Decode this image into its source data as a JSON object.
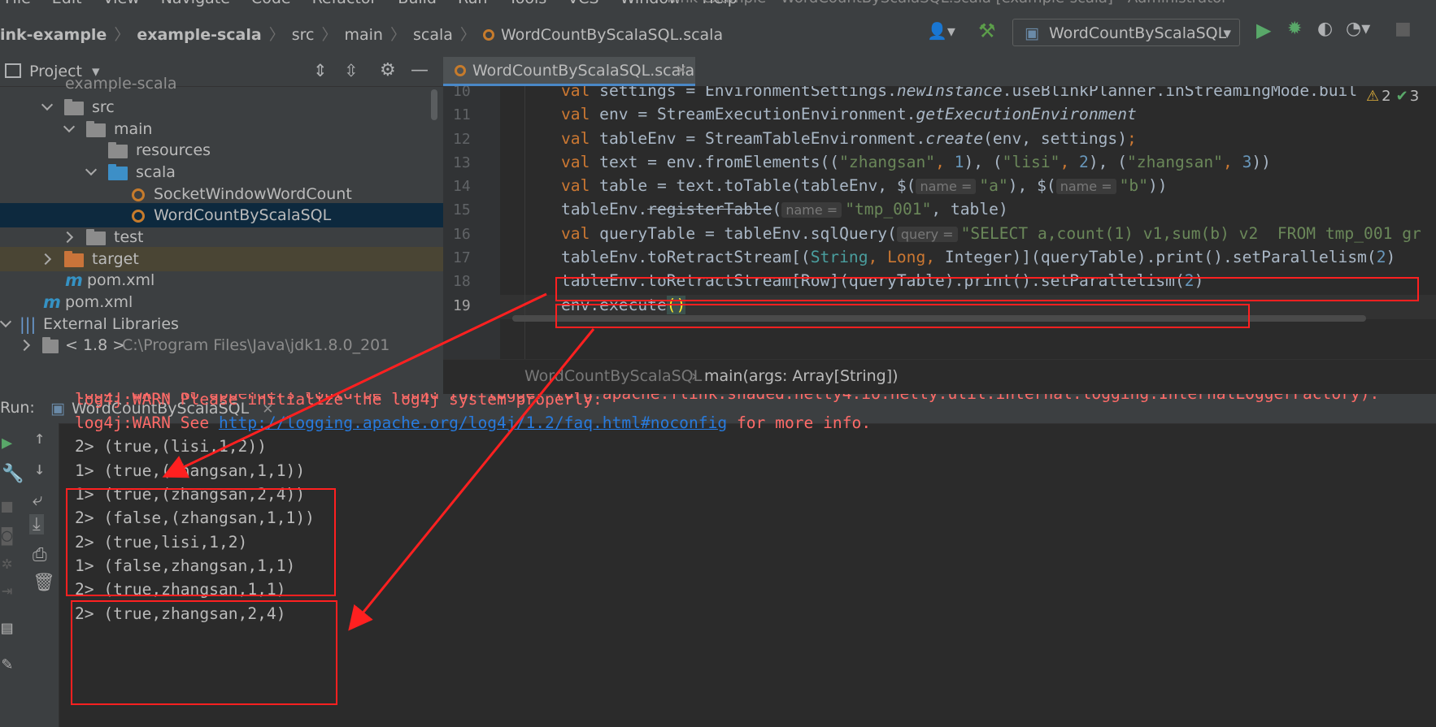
{
  "menubar": {
    "items": [
      "File",
      "Edit",
      "View",
      "Navigate",
      "Code",
      "Refactor",
      "Build",
      "Run",
      "Tools",
      "VCS",
      "Window",
      "Help"
    ],
    "window_title": "flink-example - WordCountByScalaSQL.scala [example-scala] - Administrator"
  },
  "breadcrumb": {
    "items": [
      "ink-example",
      "example-scala",
      "src",
      "main",
      "scala",
      "WordCountByScalaSQL.scala"
    ]
  },
  "toolbar": {
    "run_config": "WordCountByScalaSQL"
  },
  "project": {
    "title": "Project",
    "tree": [
      {
        "label": "example-scala",
        "kind": "module",
        "depth": 1
      },
      {
        "label": "src",
        "kind": "folder",
        "depth": 2,
        "expanded": true
      },
      {
        "label": "main",
        "kind": "folder",
        "depth": 3,
        "expanded": true
      },
      {
        "label": "resources",
        "kind": "resources-folder",
        "depth": 4
      },
      {
        "label": "scala",
        "kind": "source-folder",
        "depth": 4,
        "expanded": true
      },
      {
        "label": "SocketWindowWordCount",
        "kind": "scala-object",
        "depth": 5
      },
      {
        "label": "WordCountByScalaSQL",
        "kind": "scala-object",
        "depth": 5,
        "selected": true
      },
      {
        "label": "test",
        "kind": "folder",
        "depth": 3,
        "expanded": false
      },
      {
        "label": "target",
        "kind": "excluded-folder",
        "depth": 2,
        "expanded": false
      },
      {
        "label": "pom.xml",
        "kind": "maven",
        "depth": 2
      },
      {
        "label": "pom.xml",
        "kind": "maven",
        "depth": 1
      },
      {
        "label": "External Libraries",
        "kind": "libraries",
        "depth": 0,
        "expanded": true
      },
      {
        "label": "< 1.8 >",
        "kind": "jdk",
        "depth": 1,
        "detail": "C:\\Program Files\\Java\\jdk1.8.0_201"
      }
    ]
  },
  "editor": {
    "tab_label": "WordCountByScalaSQL.scala",
    "line_numbers": [
      "10",
      "11",
      "12",
      "13",
      "14",
      "15",
      "16",
      "17",
      "18",
      "19"
    ],
    "warnings": "2",
    "checks": "3",
    "breadcrumb_object": "WordCountByScalaSQL",
    "breadcrumb_method": "main(args: Array[String])",
    "hint_name": "name =",
    "hint_query": "query =",
    "code": {
      "l10_a": "val",
      "l10_b": " settings = EnvironmentSettings.",
      "l10_c": "newInstance",
      "l10_d": ".useBlinkPlanner.inStreamingMode.buil",
      "l11_a": "val",
      "l11_b": " env = StreamExecutionEnvironment.",
      "l11_c": "getExecutionEnvironment",
      "l12_a": "val",
      "l12_b": " tableEnv = StreamTableEnvironment.",
      "l12_c": "create",
      "l12_d": "(env, settings)",
      "l12_e": ";",
      "l13_a": "val",
      "l13_b": " text = env.fromElements((",
      "l13_c": "\"zhangsan\"",
      "l13_d": ", ",
      "l13_e": "1",
      "l13_f": "), (",
      "l13_g": "\"lisi\"",
      "l13_h": ", ",
      "l13_i": "2",
      "l13_j": "), (",
      "l13_k": "\"zhangsan\"",
      "l13_l": ", ",
      "l13_m": "3",
      "l13_n": "))",
      "l14_a": "val",
      "l14_b": " table = text.toTable(tableEnv, $(",
      "l14_c": "\"a\"",
      "l14_d": "), $(",
      "l14_e": "\"b\"",
      "l14_f": "))",
      "l15_a": "tableEnv.",
      "l15_b": "registerTable",
      "l15_c": "(",
      "l15_d": "\"tmp_001\"",
      "l15_e": ", table)",
      "l16_a": "val",
      "l16_b": " queryTable = tableEnv.sqlQuery(",
      "l16_c": "\"SELECT a,count(1) v1,sum(b) v2  FROM tmp_001 gr",
      "l17_a": "tableEnv.toRetractStream[(",
      "l17_b": "String",
      "l17_c": ", ",
      "l17_d": "Long",
      "l17_e": ", ",
      "l17_f": "Integer",
      "l17_g": ")](queryTable).print().setParallelism(",
      "l17_h": "2",
      "l17_i": ")",
      "l18_a": "tableEnv.toRetractStream[Row](queryTable).print().setParallelism(",
      "l18_b": "2",
      "l18_c": ")",
      "l19_a": "env.execute",
      "l19_b": "()"
    }
  },
  "run": {
    "label": "Run:",
    "tab_label": "WordCountByScalaSQL",
    "log_partial": "log4j:WARN No appenders could be found for logger (org.apache.flink.shaded.netty4.io.netty.util.internal.logging.InternalLoggerFactory).",
    "log_1": "log4j:WARN Please initialize the log4j system properly.",
    "log_2_a": "log4j:WARN See ",
    "log_2_link": "http://logging.apache.org/log4j/1.2/faq.html#noconfig",
    "log_2_b": " for more info.",
    "output_group_1": [
      "2> (true,(lisi,1,2))",
      "1> (true,(zhangsan,1,1))",
      "1> (true,(zhangsan,2,4))",
      "2> (false,(zhangsan,1,1))"
    ],
    "output_group_2": [
      "2> (true,lisi,1,2)",
      "1> (false,zhangsan,1,1)",
      "2> (true,zhangsan,1,1)",
      "2> (true,zhangsan,2,4)"
    ]
  },
  "colors": {
    "annotation_red": "#ff2020",
    "keyword": "#cc7832",
    "string": "#6a8759",
    "number": "#6897bb",
    "error_text": "#ff6b68",
    "link": "#287bde"
  }
}
